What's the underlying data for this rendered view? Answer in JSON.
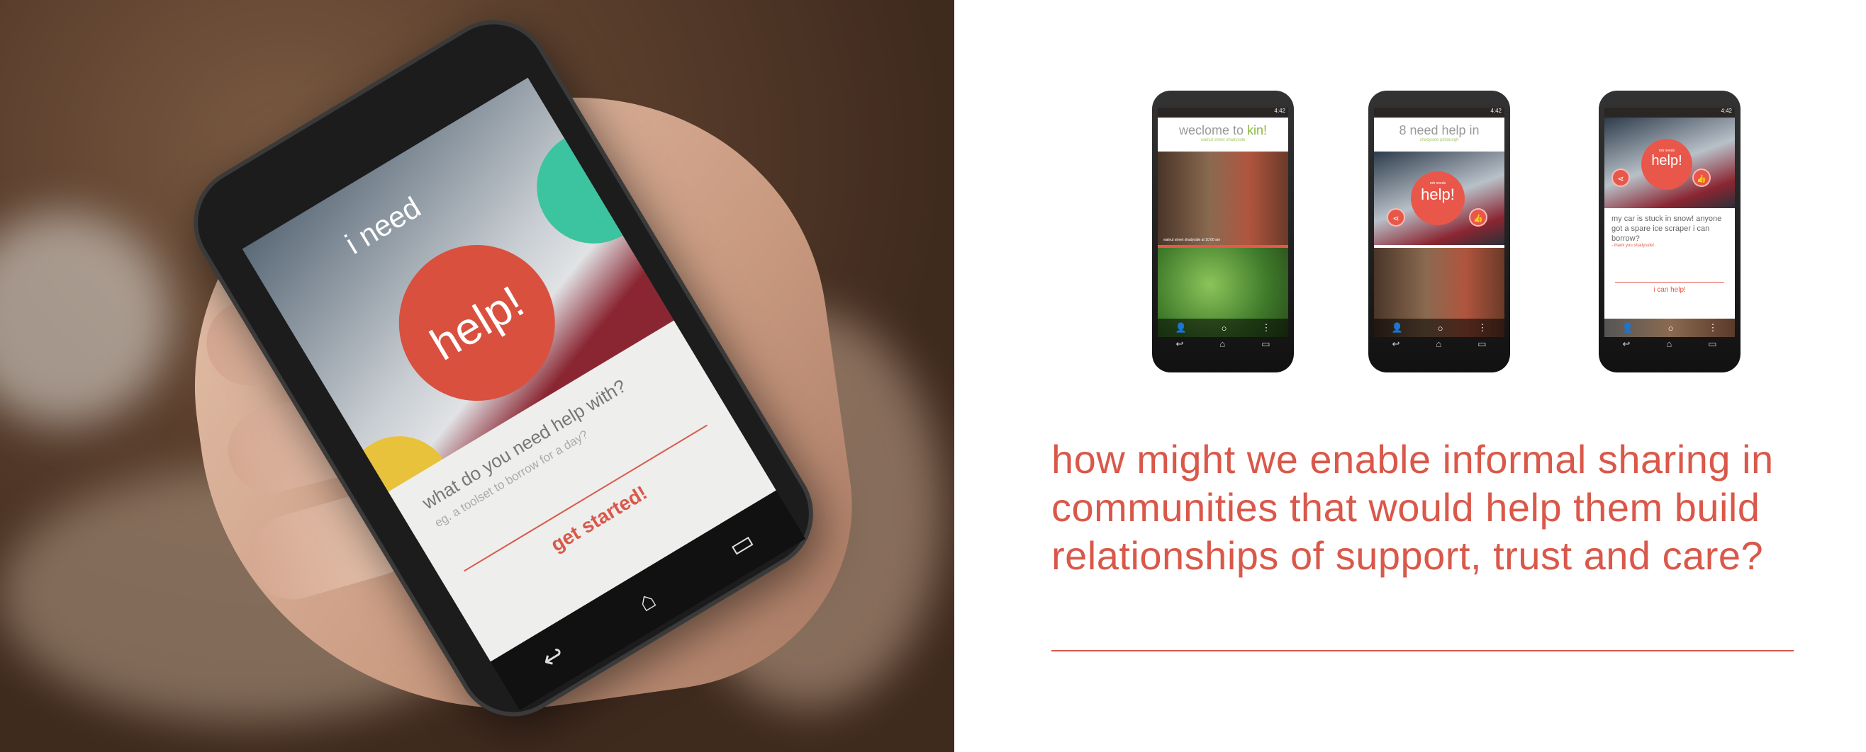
{
  "left_photo": {
    "screen": {
      "title": "i need",
      "bubble": "help!",
      "question": "what do you need help with?",
      "placeholder": "eg. a toolset to borrow for a day?",
      "cta": "get started!"
    }
  },
  "phones": [
    {
      "time": "4:42",
      "title_prefix": "weclome to ",
      "title_accent": "kin!",
      "subtitle": "walnut street shadyside",
      "caption": "walnut street shadyside at 10:00 am"
    },
    {
      "time": "4:42",
      "title": "8 need help in",
      "subtitle": "shadyside pittsburgh",
      "bubble_small": "rob needs",
      "bubble": "help!"
    },
    {
      "time": "4:42",
      "bubble_small": "rob needs",
      "bubble": "help!",
      "message": "my car is stuck in snow! anyone got a spare ice scraper i can borrow?",
      "thanks": "- thank you shadyside!",
      "cta": "i can help!"
    }
  ],
  "headline": "how might we enable informal sharing in communities that would help them build relationships of support, trust and care?",
  "colors": {
    "accent": "#d9584a",
    "green": "#8ab840",
    "teal": "#3cc4a0",
    "yellow": "#e8c23a"
  }
}
